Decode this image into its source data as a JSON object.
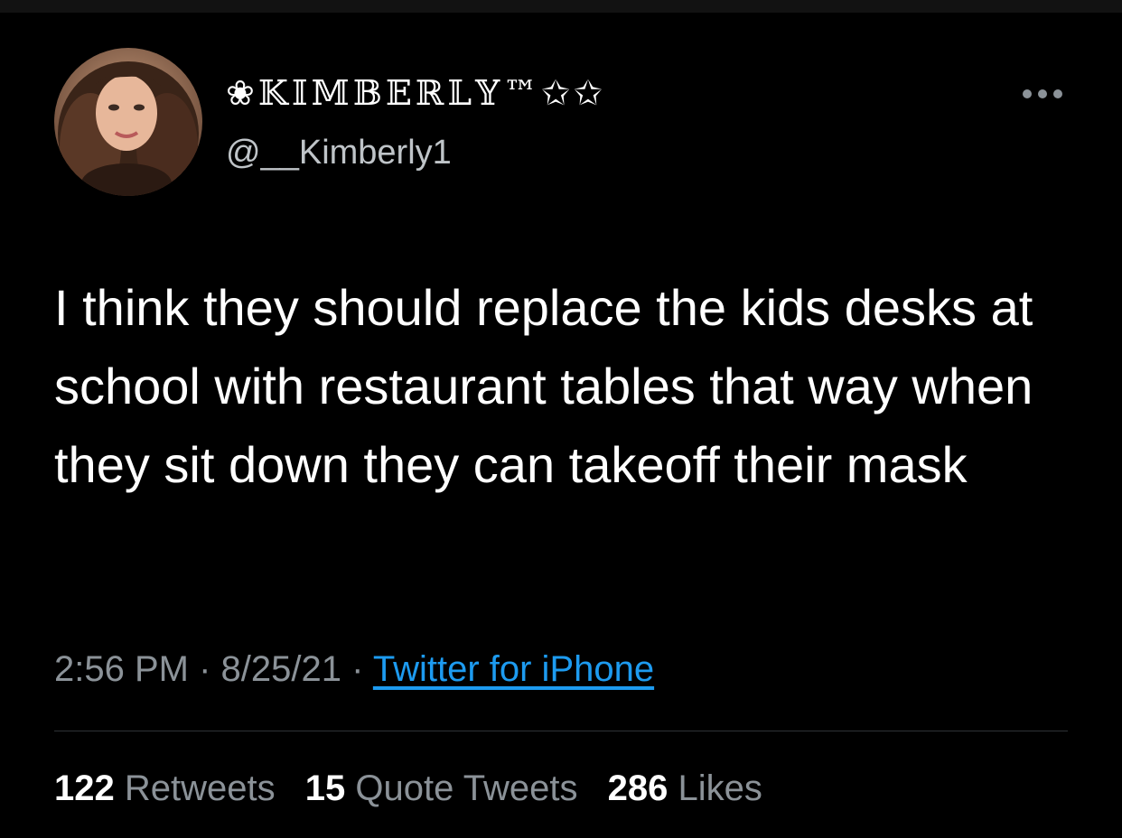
{
  "tweet": {
    "display_name": "❀𝕂𝕀𝕄𝔹𝔼ℝ𝕃𝕐™✩✩",
    "handle": "@__Kimberly1",
    "text": "I think they should replace the kids desks at school with restaurant tables that way when they sit down they can takeoff their mask",
    "time": "2:56 PM",
    "separator": "·",
    "date": "8/25/21",
    "source": "Twitter for iPhone"
  },
  "stats": {
    "retweets_count": "122",
    "retweets_label": "Retweets",
    "quotes_count": "15",
    "quotes_label": "Quote Tweets",
    "likes_count": "286",
    "likes_label": "Likes"
  },
  "icons": {
    "more": "more-horizontal-icon"
  },
  "colors": {
    "background": "#000000",
    "text": "#ffffff",
    "secondary": "#8b9298",
    "link": "#1d9bf0",
    "divider": "#2f3336"
  }
}
